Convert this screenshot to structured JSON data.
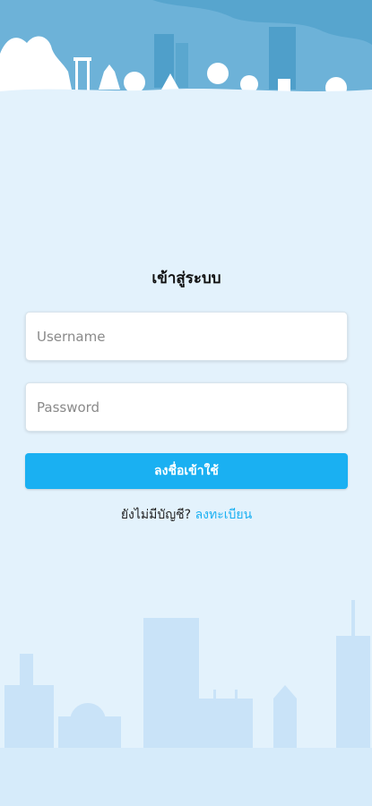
{
  "login": {
    "title": "เข้าสู่ระบบ",
    "username_placeholder": "Username",
    "password_placeholder": "Password",
    "button_label": "ลงชื่อเข้าใช้",
    "signup_prompt": "ยังไม่มีบัญชี?",
    "signup_link": "ลงทะเบียน"
  },
  "colors": {
    "background": "#e3f2fc",
    "accent": "#1ab0f2",
    "skyline_top": "#5aa7cf",
    "skyline_bottom": "#c9e3f8"
  }
}
